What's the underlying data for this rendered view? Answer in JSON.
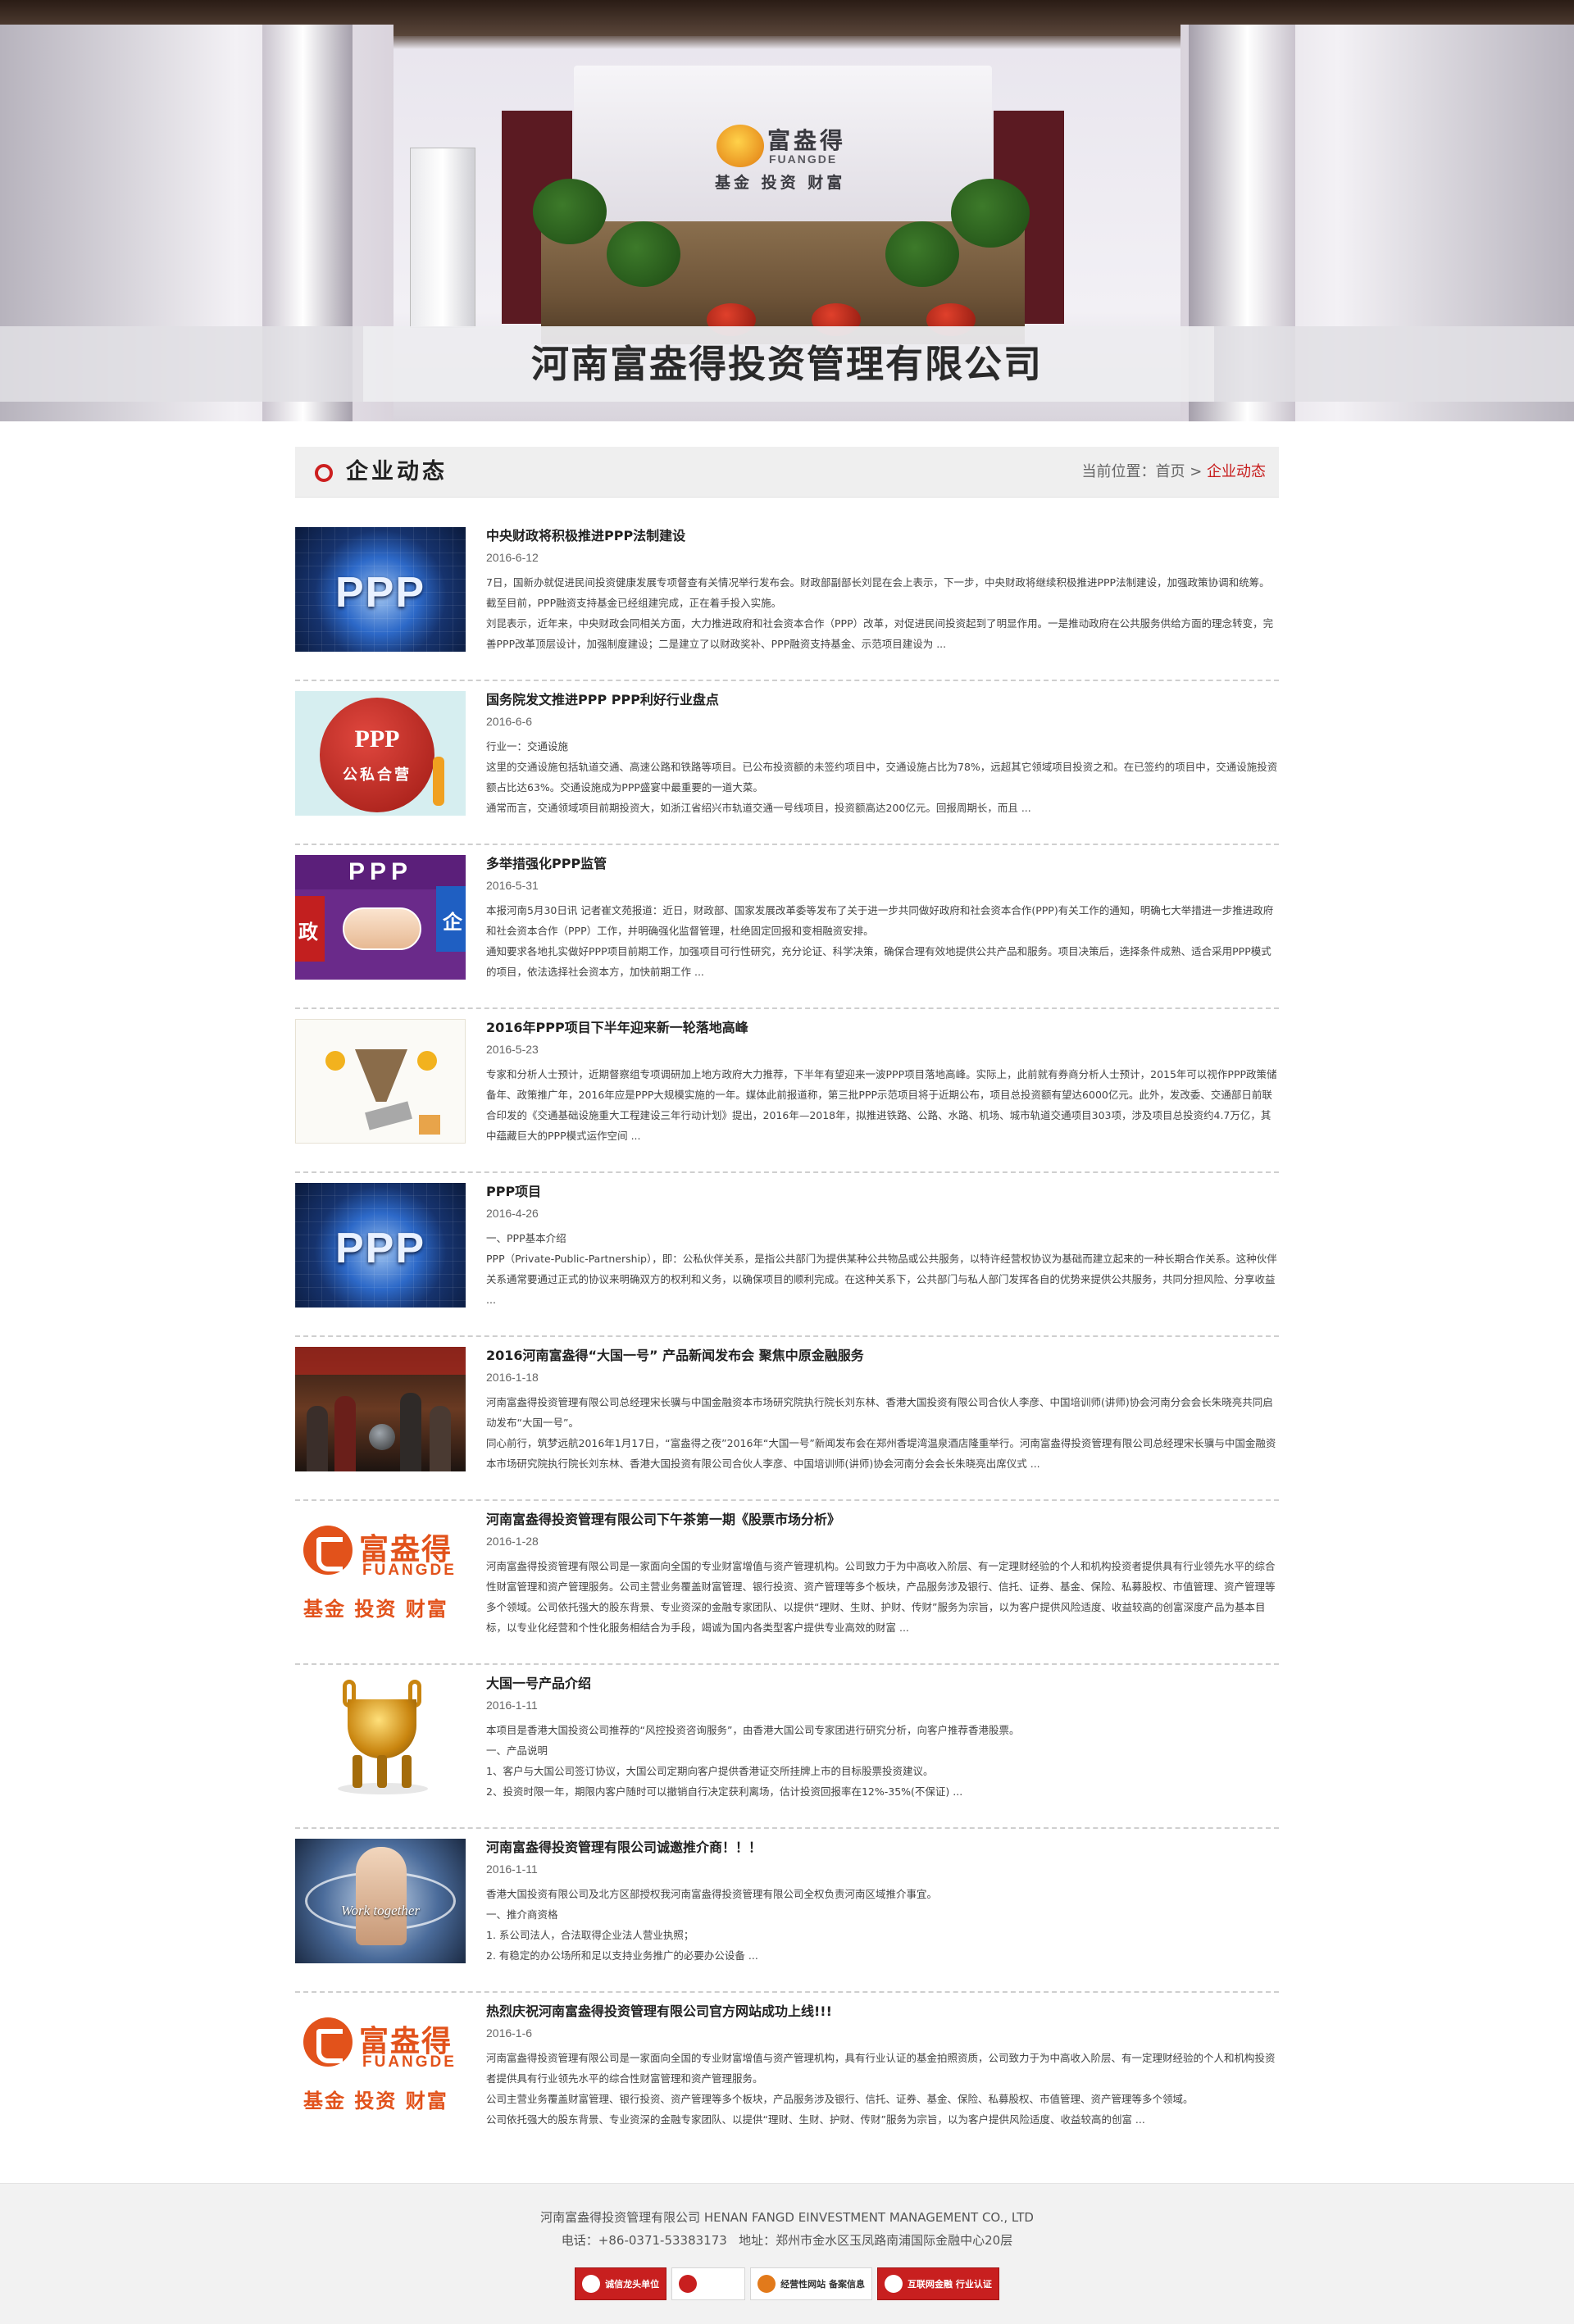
{
  "banner": {
    "company_title": "河南富盎得投资管理有限公司",
    "logo_cn": "富盎得",
    "logo_en": "FUANGDE",
    "logo_slogan": "基金 投资 财富"
  },
  "section": {
    "title": "企业动态",
    "breadcrumb": {
      "prefix": "当前位置：",
      "home": "首页",
      "separator": " > ",
      "current": "企业动态"
    }
  },
  "news": [
    {
      "thumb": "ppp-globe-image",
      "thumb_text": "PPP",
      "title": "中央财政将积极推进PPP法制建设",
      "date": "2016-6-12",
      "summary": "7日，国新办就促进民间投资健康发展专项督查有关情况举行发布会。财政部副部长刘昆在会上表示，下一步，中央财政将继续积极推进PPP法制建设，加强政策协调和统筹。截至目前，PPP融资支持基金已经组建完成，正在着手投入实施。\n刘昆表示，近年来，中央财政会同相关方面，大力推进政府和社会资本合作（PPP）改革，对促进民间投资起到了明显作用。一是推动政府在公共服务供给方面的理念转变，完善PPP改革顶层设计，加强制度建设；二是建立了以财政奖补、PPP融资支持基金、示范项目建设为 ..."
    },
    {
      "thumb": "ppp-seal-image",
      "thumb_text": "PPP",
      "thumb_text2": "公私合营",
      "title": "国务院发文推进PPP PPP利好行业盘点",
      "date": "2016-6-6",
      "summary": "行业一：交通设施\n这里的交通设施包括轨道交通、高速公路和铁路等项目。已公布投资额的未签约项目中，交通设施占比为78%，远超其它领域项目投资之和。在已签约的项目中，交通设施投资额占比达63%。交通设施成为PPP盛宴中最重要的一道大菜。\n通常而言，交通领域项目前期投资大，如浙江省绍兴市轨道交通一号线项目，投资额高达200亿元。回报周期长，而且 ..."
    },
    {
      "thumb": "ppp-handshake-image",
      "thumb_text": "PPP",
      "thumb_left": "政",
      "thumb_right": "企",
      "title": "多举措强化PPP监管",
      "date": "2016-5-31",
      "summary": "本报河南5月30日讯 记者崔文苑报道：近日，财政部、国家发展改革委等发布了关于进一步共同做好政府和社会资本合作(PPP)有关工作的通知，明确七大举措进一步推进政府和社会资本合作（PPP）工作，并明确强化监督管理，杜绝固定回报和变相融资安排。\n通知要求各地扎实做好PPP项目前期工作，加强项目可行性研究，充分论证、科学决策，确保合理有效地提供公共产品和服务。项目决策后，选择条件成熟、适合采用PPP模式的项目，依法选择社会资本方，加快前期工作 ..."
    },
    {
      "thumb": "ppp-diagram-image",
      "title": "2016年PPP项目下半年迎来新一轮落地高峰",
      "date": "2016-5-23",
      "summary": "专家和分析人士预计，近期督察组专项调研加上地方政府大力推荐，下半年有望迎来一波PPP项目落地高峰。实际上，此前就有券商分析人士预计，2015年可以视作PPP政策储备年、政策推广年，2016年应是PPP大规模实施的一年。媒体此前报道称，第三批PPP示范项目将于近期公布，项目总投资额有望达6000亿元。此外，发改委、交通部日前联合印发的《交通基础设施重大工程建设三年行动计划》提出，2016年—2018年，拟推进铁路、公路、水路、机场、城市轨道交通项目303项，涉及项目总投资约4.7万亿，其中蕴藏巨大的PPP模式运作空间 ..."
    },
    {
      "thumb": "ppp-globe-image",
      "thumb_text": "PPP",
      "title": "PPP项目",
      "date": "2016-4-26",
      "summary": "一、PPP基本介绍\nPPP（Private-Public-Partnership），即：公私伙伴关系，是指公共部门为提供某种公共物品或公共服务，以特许经营权协议为基础而建立起来的一种长期合作关系。这种伙伴关系通常要通过正式的协议来明确双方的权利和义务，以确保项目的顺利完成。在这种关系下，公共部门与私人部门发挥各自的优势来提供公共服务，共同分担风险、分享收益 ..."
    },
    {
      "thumb": "launch-event-image",
      "title": "2016河南富盎得“大国一号” 产品新闻发布会 聚焦中原金融服务",
      "date": "2016-1-18",
      "summary": "河南富盎得投资管理有限公司总经理宋长骥与中国金融资本市场研究院执行院长刘东林、香港大国投资有限公司合伙人李彦、中国培训师(讲师)协会河南分会会长朱晓亮共同启动发布“大国一号”。\n同心前行，筑梦远航2016年1月17日，“富盎得之夜”2016年“大国一号”新闻发布会在郑州香堤湾温泉酒店隆重举行。河南富盎得投资管理有限公司总经理宋长骥与中国金融资本市场研究院执行院长刘东林、香港大国投资有限公司合伙人李彦、中国培训师(讲师)协会河南分会会长朱晓亮出席仪式 ..."
    },
    {
      "thumb": "fuangde-logo-image",
      "title": "河南富盎得投资管理有限公司下午茶第一期《股票市场分析》",
      "date": "2016-1-28",
      "summary": "河南富盎得投资管理有限公司是一家面向全国的专业财富增值与资产管理机构。公司致力于为中高收入阶层、有一定理财经验的个人和机构投资者提供具有行业领先水平的综合性财富管理和资产管理服务。公司主营业务覆盖财富管理、银行投资、资产管理等多个板块，产品服务涉及银行、信托、证券、基金、保险、私募股权、市值管理、资产管理等多个领域。公司依托强大的股东背景、专业资深的金融专家团队、以提供“理财、生财、护财、传财”服务为宗旨，以为客户提供风险适度、收益较高的创富深度产品为基本目标，以专业化经营和个性化服务相结合为手段，竭诚为国内各类型客户提供专业高效的财富 ..."
    },
    {
      "thumb": "bronze-ding-image",
      "title": "大国一号产品介绍",
      "date": "2016-1-11",
      "summary": "本项目是香港大国投资公司推荐的“风控投资咨询服务”，由香港大国公司专家团进行研究分析，向客户推荐香港股票。\n一、产品说明\n1、客户与大国公司签订协议，大国公司定期向客户提供香港证交所挂牌上市的目标股票投资建议。\n2、投资时限一年，期限内客户随时可以撤销自行决定获利离场，估计投资回报率在12%-35%(不保证) ..."
    },
    {
      "thumb": "together-fist-image",
      "thumb_text": "Work together",
      "title": "河南富盎得投资管理有限公司诚邀推介商！！！",
      "date": "2016-1-11",
      "summary": "香港大国投资有限公司及北方区部授权我河南富盎得投资管理有限公司全权负责河南区域推介事宜。\n一、推介商资格\n1. 系公司法人，合法取得企业法人营业执照；\n2. 有稳定的办公场所和足以支持业务推广的必要办公设备 ..."
    },
    {
      "thumb": "fuangde-logo-image",
      "title": "热烈庆祝河南富盎得投资管理有限公司官方网站成功上线!!!",
      "date": "2016-1-6",
      "summary": "河南富盎得投资管理有限公司是一家面向全国的专业财富增值与资产管理机构，具有行业认证的基金拍照资质，公司致力于为中高收入阶层、有一定理财经验的个人和机构投资者提供具有行业领先水平的综合性财富管理和资产管理服务。\n公司主营业务覆盖财富管理、银行投资、资产管理等多个板块，产品服务涉及银行、信托、证券、基金、保险、私募股权、市值管理、资产管理等多个领域。\n公司依托强大的股东背景、专业资深的金融专家团队、以提供“理财、生财、护财、传财”服务为宗旨，以为客户提供风险适度、收益较高的创富 ..."
    }
  ],
  "footer": {
    "company_line": "河南富盎得投资管理有限公司 HENAN FANGD EINVESTMENT MANAGEMENT CO., LTD",
    "contact_line": "电话：+86-0371-53383173   地址：郑州市金水区玉凤路南浦国际金融中心20层",
    "badges": [
      {
        "label": "诚信龙头单位",
        "icon": "credit-icon",
        "color": "#c81f1f"
      },
      {
        "label": "",
        "icon": "verified-icon",
        "color": "#ffffff"
      },
      {
        "label": "经营性网站 备案信息",
        "icon": "filing-icon",
        "color": "#ffffff"
      },
      {
        "label": "互联网金融 行业认证",
        "icon": "certification-icon",
        "color": "#c81f1f"
      }
    ]
  }
}
